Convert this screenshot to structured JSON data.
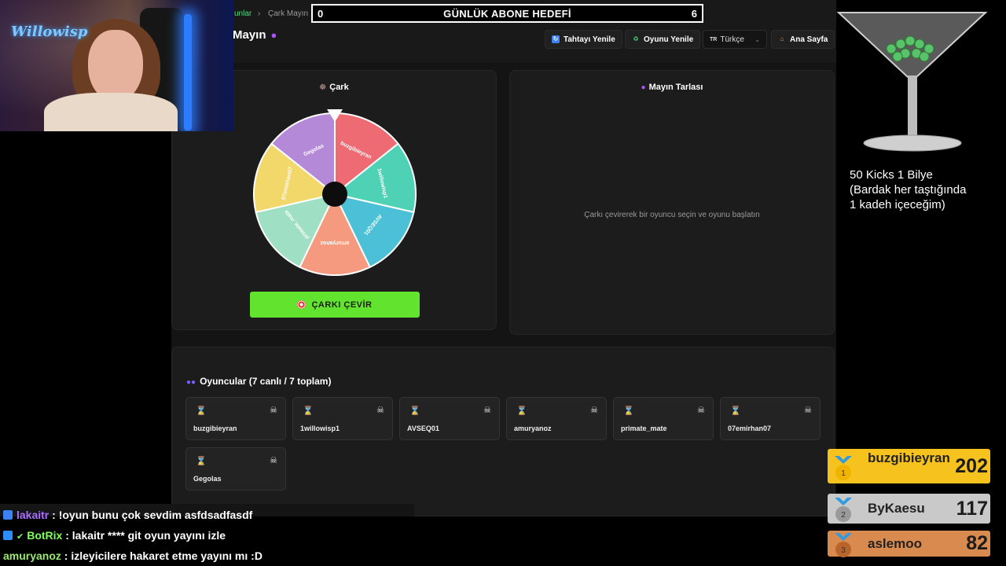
{
  "app": {
    "breadcrumb": {
      "prev": "unlar",
      "separator": "›",
      "current": "Çark Mayın"
    },
    "page_title": "Mayın",
    "buttons": {
      "refresh_board": "Tahtayı Yenile",
      "refresh_game": "Oyunu Yenile",
      "home": "Ana Sayfa"
    },
    "language": {
      "flag": "TR",
      "value": "Türkçe"
    },
    "wheel_panel": {
      "title": "Çark",
      "spin_button": "ÇARKI ÇEVİR"
    },
    "mine_panel": {
      "title": "Mayın Tarlası",
      "message": "Çarkı çevirerek bir oyuncu seçin ve oyunu başlatın"
    },
    "players_panel": {
      "title": "Oyuncular (7 canlı / 7 toplam)",
      "players": [
        "buzgibieyran",
        "1willowisp1",
        "AVSEQ01",
        "amuryanoz",
        "primate_mate",
        "07emirhan07",
        "Gegolas"
      ]
    }
  },
  "wheel": {
    "segments": [
      {
        "label": "buzgibieyran",
        "color": "#ef6b73"
      },
      {
        "label": "1willowisp1",
        "color": "#4fd1b5"
      },
      {
        "label": "AVSEQ01",
        "color": "#4bc0d6"
      },
      {
        "label": "amuryanoz",
        "color": "#f59a7e"
      },
      {
        "label": "primate_mate",
        "color": "#9fdfc4"
      },
      {
        "label": "07emirhan07",
        "color": "#f2d86a"
      },
      {
        "label": "Gegolas",
        "color": "#b48ad8"
      }
    ]
  },
  "overlay": {
    "goal": {
      "current": "0",
      "title": "GÜNLÜK ABONE HEDEFİ",
      "target": "6"
    },
    "side_note": "50 Kicks 1 Bilye\n(Bardak her taştığında\n1 kadeh içeceğim)",
    "webcam_logo": "Willowisp",
    "leaderboard": [
      {
        "rank": "1",
        "name": "buzgibieyran",
        "score": "202",
        "color": "#f6c21d",
        "medal": "#f0b400"
      },
      {
        "rank": "2",
        "name": "ByKaesu",
        "score": "117",
        "color": "#c9c9c9",
        "medal": "#9a9a9a"
      },
      {
        "rank": "3",
        "name": "aslemoo",
        "score": "82",
        "color": "#d98a4e",
        "medal": "#b8642a"
      }
    ],
    "chat": [
      {
        "user": "lakaitr",
        "text": " : !oyun bunu çok sevdim asfdsadfasdf",
        "user_color": "#a970ff",
        "badge": "#3b82f6"
      },
      {
        "user": "BotRix",
        "text": " : lakaitr **** git oyun yayını izle",
        "user_color": "#7cff5a",
        "badge": "#2d8cff"
      },
      {
        "user": "amuryanoz",
        "text": " : izleyicilere hakaret etme yayını mı :D",
        "user_color": "#9be870",
        "badge": ""
      }
    ]
  }
}
